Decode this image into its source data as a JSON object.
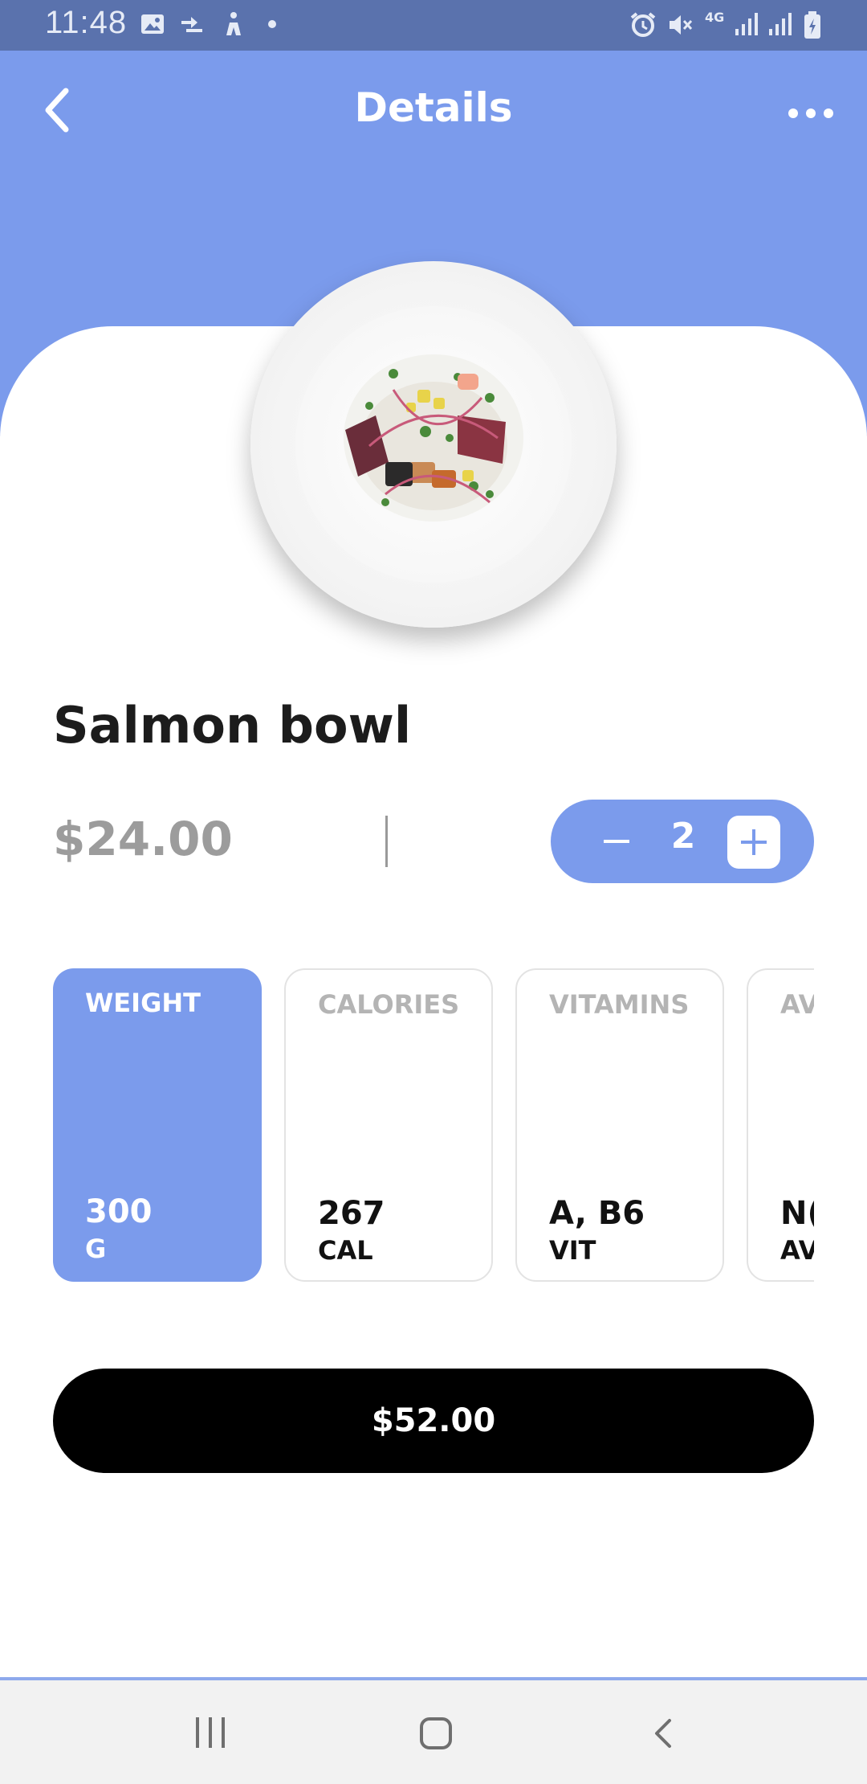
{
  "status_bar": {
    "time": "11:48",
    "icons": [
      "gallery-icon",
      "sync-icon",
      "accessibility-icon",
      "dot-icon",
      "alarm-icon",
      "mute-icon",
      "4g-icon",
      "signal-icon",
      "signal-icon",
      "battery-icon"
    ],
    "network": "4G"
  },
  "header": {
    "title": "Details",
    "back_icon": "back-arrow-icon",
    "menu_icon": "more-dots-icon"
  },
  "product": {
    "name": "Salmon bowl",
    "price": "$24.00",
    "image": "salmon-bowl-plate"
  },
  "stepper": {
    "quantity": "2",
    "minus_icon": "minus-icon",
    "plus_icon": "plus-icon"
  },
  "cards": [
    {
      "label": "WEIGHT",
      "value": "300",
      "unit": "G",
      "active": true
    },
    {
      "label": "CALORIES",
      "value": "267",
      "unit": "CAL",
      "active": false
    },
    {
      "label": "VITAMINS",
      "value": "A, B6",
      "unit": "VIT",
      "active": false
    },
    {
      "label": "AV",
      "value": "N(",
      "unit": "AV",
      "active": false
    }
  ],
  "total_button": {
    "label": "$52.00"
  },
  "nav_bar": {
    "icons": [
      "recent-apps-icon",
      "home-icon",
      "back-icon"
    ]
  },
  "colors": {
    "accent": "#7b9bec",
    "status_bar": "#5a72ad",
    "text_dark": "#1c1c1c",
    "price_gray": "#9c9c9c",
    "button_black": "#000000"
  }
}
